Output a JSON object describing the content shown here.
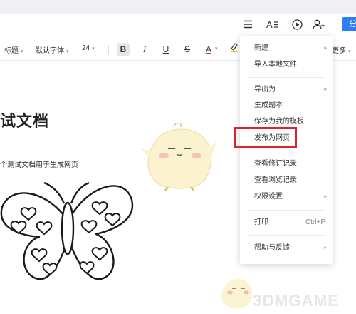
{
  "header": {
    "share_label": "分",
    "icons": [
      "menu-icon",
      "text-style-icon",
      "play-icon",
      "add-user-icon"
    ]
  },
  "toolbar": {
    "style": "标题",
    "font": "默认字体",
    "size": "24",
    "bold": "B",
    "italic": "I",
    "underline": "U",
    "strike": "S",
    "font_color": "A",
    "more": "更多"
  },
  "document": {
    "title": "试文档",
    "body": "个测试文档用于生成网页"
  },
  "menu": {
    "new": "新建",
    "import_local": "导入本地文件",
    "export_as": "导出为",
    "create_copy": "生成副本",
    "save_template": "保存为我的模板",
    "publish_web": "发布为网页",
    "view_revisions": "查看修订记录",
    "view_browse": "查看浏览记录",
    "permissions": "权限设置",
    "print": "打印",
    "print_shortcut": "Ctrl+P",
    "help": "帮助与反馈"
  },
  "watermark": "3DMGAME",
  "colors": {
    "accent": "#2f7cf6",
    "highlight": "#d9262e",
    "font_color_underline": "#e33"
  }
}
